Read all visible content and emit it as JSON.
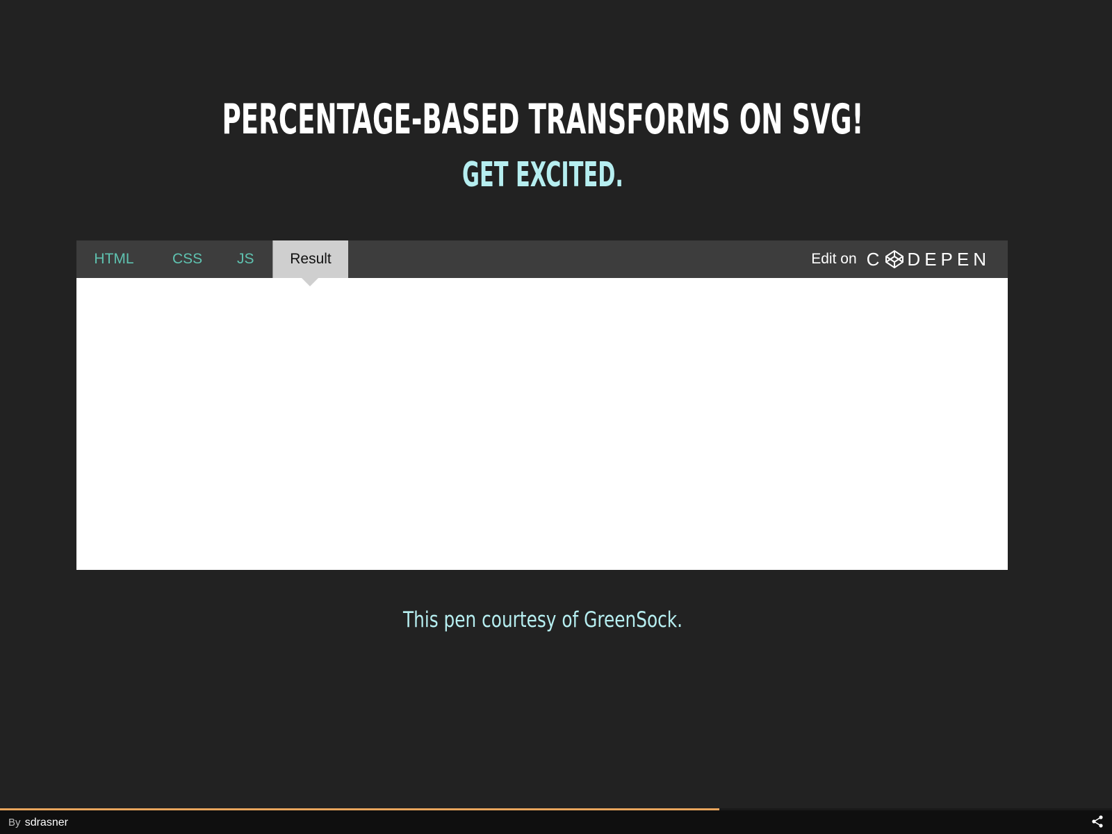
{
  "page": {
    "title": "PERCENTAGE-BASED TRANSFORMS ON SVG!",
    "subtitle": "GET EXCITED.",
    "courtesy": "This pen courtesy of GreenSock."
  },
  "embed": {
    "tabs": [
      {
        "label": "HTML",
        "active": false
      },
      {
        "label": "CSS",
        "active": false
      },
      {
        "label": "JS",
        "active": false
      },
      {
        "label": "Result",
        "active": true
      }
    ],
    "edit_on_label": "Edit on",
    "brand_name": "DEPEN",
    "brand_first_letter": "C",
    "brand_icon": "codepen-cube-icon"
  },
  "footer": {
    "by_label": "By",
    "author": "sdrasner",
    "progress_fraction": 0.647,
    "share_icon": "share-icon"
  },
  "colors": {
    "background": "#222222",
    "title": "#ffffff",
    "accent_cyan": "#b6eef0",
    "tab_text": "#5fc2b0",
    "tab_bar": "#3d3d3d",
    "active_tab": "#cfcfcf",
    "progress": "#e8a55c",
    "footer": "#0f0f0f"
  }
}
